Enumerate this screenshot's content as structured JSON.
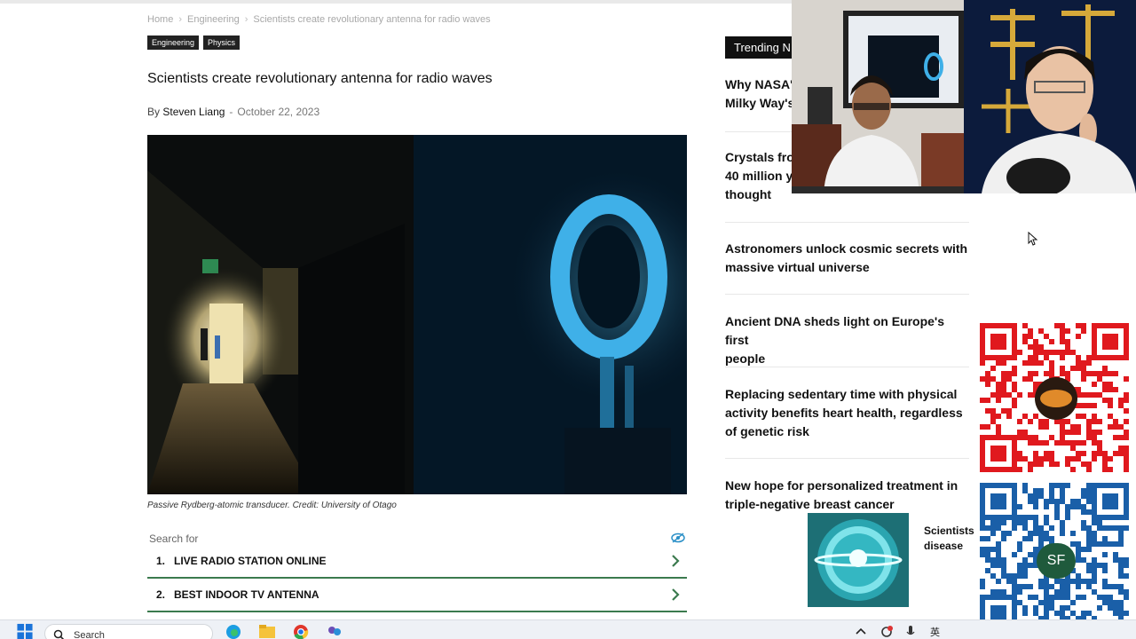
{
  "breadcrumb": {
    "home": "Home",
    "section": "Engineering",
    "current": "Scientists create revolutionary antenna for radio waves"
  },
  "tags": [
    "Engineering",
    "Physics"
  ],
  "article": {
    "title": "Scientists create revolutionary antenna for radio waves",
    "by": "By",
    "author": "Steven Liang",
    "date": "October 22, 2023",
    "caption": "Passive Rydberg-atomic transducer. Credit: University of Otago"
  },
  "ads": {
    "search_for": "Search for",
    "items": [
      {
        "num": "1.",
        "label": "LIVE RADIO STATION ONLINE"
      },
      {
        "num": "2.",
        "label": "BEST INDOOR TV ANTENNA"
      }
    ]
  },
  "trending": {
    "heading": "Trending N",
    "items": [
      {
        "line1": "Why NASA's",
        "line2": "Milky Way's"
      },
      {
        "line1": "Crystals fro",
        "line2": "40 million y",
        "line3": "thought"
      },
      {
        "line1": "Astronomers unlock cosmic secrets with",
        "line2": "massive virtual universe"
      },
      {
        "line1": "Ancient DNA sheds light on Europe's first",
        "line2": "people"
      },
      {
        "line1": "Replacing sedentary time with physical",
        "line2": "activity benefits heart health, regardless",
        "line3": "of genetic risk"
      },
      {
        "line1": "New hope for personalized treatment in",
        "line2": "triple-negative breast cancer"
      }
    ]
  },
  "related": {
    "line1": "Scientists",
    "line2": "disease"
  },
  "overlay": {
    "qr_badge": "SF"
  },
  "taskbar": {
    "search_placeholder": "Search",
    "tray_lang": "英"
  },
  "colors": {
    "accent_green": "#3b7a4e",
    "qr_red": "#e0191e",
    "qr_blue": "#1a5fa8"
  }
}
